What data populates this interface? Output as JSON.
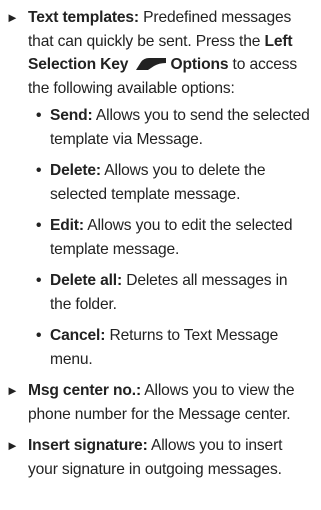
{
  "items": [
    {
      "term": "Text templates:",
      "desc_a": " Predefined messages that can quickly be sent. Press the ",
      "key_label_a": "Left Selection Key",
      "key_icon": "left-selection-key-icon",
      "key_label_b": "Options",
      "desc_b": " to access the following available options:",
      "options": [
        {
          "term": "Send:",
          "desc": " Allows you to send the selected template via Message."
        },
        {
          "term": "Delete:",
          "desc": " Allows you to delete the selected template message."
        },
        {
          "term": "Edit:",
          "desc": " Allows you to edit the selected template message."
        },
        {
          "term": "Delete all:",
          "desc": " Deletes all messages in the folder."
        },
        {
          "term": "Cancel:",
          "desc": " Returns to Text Message menu."
        }
      ]
    },
    {
      "term": "Msg center no.:",
      "desc": " Allows you to view the phone number for the Message center."
    },
    {
      "term": "Insert signature:",
      "desc": " Allows you to insert your signature in outgoing messages."
    }
  ]
}
